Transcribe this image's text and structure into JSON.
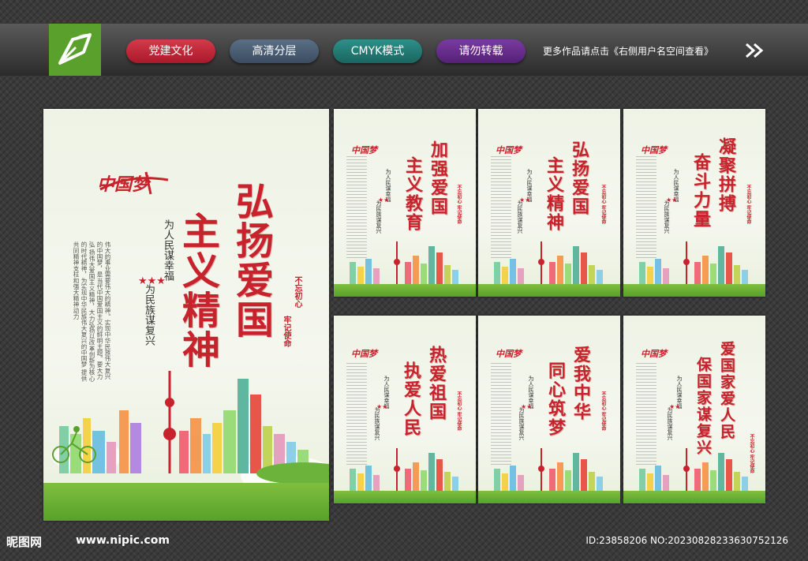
{
  "header": {
    "tags": [
      "党建文化",
      "高清分层",
      "CMYK模式",
      "请勿转载"
    ],
    "note": "更多作品请点击《右侧用户名空间查看》"
  },
  "main_poster": {
    "brand": "中国梦",
    "title_col1": "弘扬爱国",
    "title_col2": "主义精神",
    "sub_col1": "为人民谋幸福",
    "sub_col2": "为民族谋复兴",
    "seal_col1": "不忘初心",
    "seal_col2": "牢记使命",
    "body": [
      "伟大的事业需要伟大的精神。实现中华民族伟大复兴",
      "的中国梦，是当代中国爱国主义的鲜明主题。要大力弘",
      "扬伟大爱国主义精神，大力弘扬以改革创新为核心",
      "的时代精神，为实现中华民族伟大复兴的中国梦",
      "提供共同精神支柱和强大精神动力"
    ]
  },
  "small_posters": [
    {
      "title_col1": "加强爱国",
      "title_col2": "主义教育",
      "sub_col1": "为人民谋幸福",
      "sub_col2": "为民族谋复兴",
      "seal": "不忘初心 牢记使命"
    },
    {
      "title_col1": "弘扬爱国",
      "title_col2": "主义精神",
      "sub_col1": "为人民谋幸福",
      "sub_col2": "为民族谋复兴",
      "seal": "不忘初心 牢记使命"
    },
    {
      "title_col1": "凝聚拼搏",
      "title_col2": "奋斗力量",
      "sub_col1": "为人民谋幸福",
      "sub_col2": "为民族谋复兴",
      "seal": "不忘初心 牢记使命"
    },
    {
      "title_col1": "热爱祖国",
      "title_col2": "执爱人民",
      "sub_col1": "为人民谋幸福",
      "sub_col2": "为民族谋复兴",
      "seal": "不忘初心 牢记使命"
    },
    {
      "title_col1": "爱我中华",
      "title_col2": "同心筑梦",
      "sub_col1": "为人民谋幸福",
      "sub_col2": "为民族谋复兴",
      "seal": "不忘初心 牢记使命"
    },
    {
      "title_col1": "爱国家爱人民",
      "title_col2": "保国家谋复兴",
      "sub_col1": "为人民谋幸福",
      "sub_col2": "为民族谋复兴",
      "seal": "不忘初心 牢记使命"
    }
  ],
  "footer": {
    "brand": "昵图网",
    "url": "www.nipic.com",
    "id": "ID:23858206 NO:20230828233630752126"
  },
  "colors": {
    "accent_red": "#c8232c",
    "logo_green": "#5aa02c",
    "grass_green": "#7fbf3f"
  },
  "icons": [
    "logo-pen-icon",
    "double-arrow-icon",
    "star-icon",
    "cyclist-icon",
    "skyline-illustration"
  ]
}
